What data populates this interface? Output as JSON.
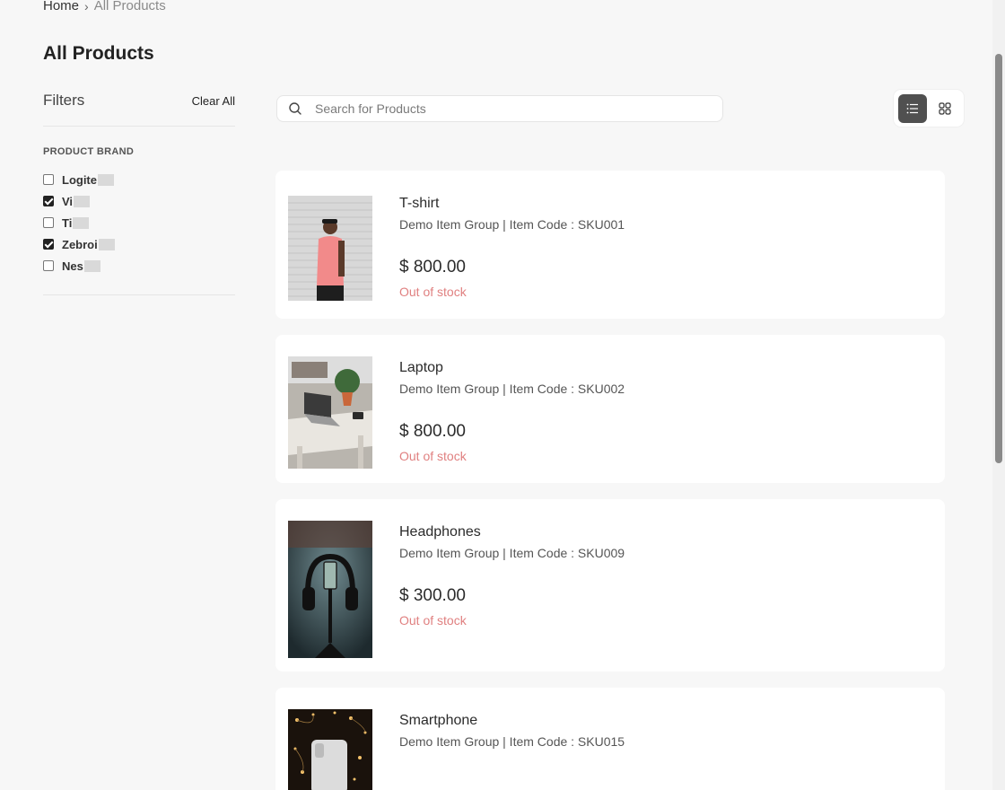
{
  "breadcrumb": {
    "home": "Home",
    "separator": "›",
    "current": "All Products"
  },
  "page": {
    "title": "All Products"
  },
  "filters": {
    "title": "Filters",
    "clear_label": "Clear All",
    "brand_section_title": "PRODUCT BRAND",
    "brands": [
      {
        "label": "Logite",
        "checked": false
      },
      {
        "label": "Vi",
        "checked": true
      },
      {
        "label": "Ti",
        "checked": false
      },
      {
        "label": "Zebroi",
        "checked": true
      },
      {
        "label": "Nes",
        "checked": false
      }
    ]
  },
  "search": {
    "placeholder": "Search for Products",
    "value": ""
  },
  "view_toggle": {
    "active": "list",
    "options": [
      "list-view-icon",
      "grid-view-icon"
    ]
  },
  "products": [
    {
      "name": "T-shirt",
      "meta": "Demo Item Group | Item Code : SKU001",
      "price": "$ 800.00",
      "stock": "Out of stock"
    },
    {
      "name": "Laptop",
      "meta": "Demo Item Group | Item Code : SKU002",
      "price": "$ 800.00",
      "stock": "Out of stock"
    },
    {
      "name": "Headphones",
      "meta": "Demo Item Group | Item Code : SKU009",
      "price": "$ 300.00",
      "stock": "Out of stock"
    },
    {
      "name": "Smartphone",
      "meta": "Demo Item Group | Item Code : SKU015"
    }
  ],
  "colors": {
    "accent": "#505050",
    "out_of_stock": "#e08080",
    "background": "#f7f7f7"
  }
}
